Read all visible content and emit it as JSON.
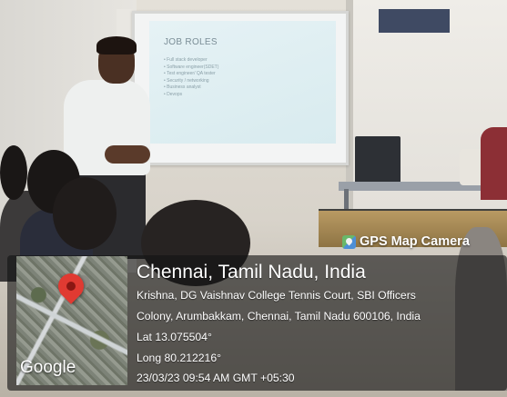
{
  "slide": {
    "title": "JOB ROLES",
    "items": [
      "Full stack developer",
      "Software engineer(SDET)",
      "Test engineer/ QA tester",
      "Security / networking",
      "Business analyst",
      "Devops"
    ]
  },
  "gps_overlay": {
    "brand": "GPS Map Camera",
    "city": "Chennai, Tamil Nadu, India",
    "address_line_1": "Krishna, DG Vaishnav College Tennis Court, SBI Officers",
    "address_line_2": "Colony, Arumbakkam, Chennai, Tamil Nadu 600106, India",
    "latitude": "Lat 13.075504°",
    "longitude": "Long 80.212216°",
    "timestamp": "23/03/23 09:54 AM GMT +05:30",
    "map_watermark": "Google",
    "pin_color": "#e03a32"
  }
}
